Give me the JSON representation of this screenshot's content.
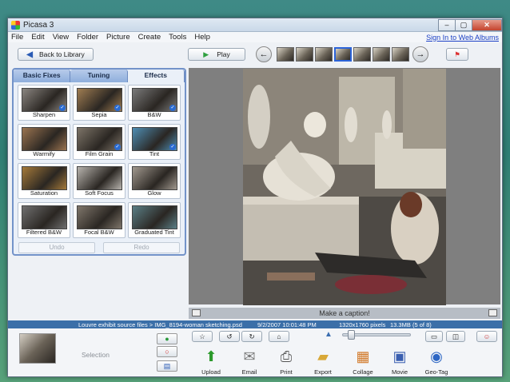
{
  "window": {
    "title": "Picasa 3",
    "controls": [
      "–",
      "▢",
      "✕"
    ]
  },
  "menu": {
    "items": [
      "File",
      "Edit",
      "View",
      "Folder",
      "Picture",
      "Create",
      "Tools",
      "Help"
    ],
    "sign_in": "Sign In to Web Albums"
  },
  "toolbar": {
    "back_label": "Back to Library",
    "play_label": "Play"
  },
  "edit_panel": {
    "tabs": [
      "Basic Fixes",
      "Tuning",
      "Effects"
    ],
    "active_tab": "Effects",
    "effects": [
      {
        "label": "Sharpen",
        "tone": "#8a8580",
        "badge": true
      },
      {
        "label": "Sepia",
        "tone": "#a07d52",
        "badge": true
      },
      {
        "label": "B&W",
        "tone": "#7a7a7a",
        "badge": true
      },
      {
        "label": "Warmify",
        "tone": "#9b7450",
        "badge": false
      },
      {
        "label": "Film Grain",
        "tone": "#7d7468",
        "badge": true
      },
      {
        "label": "Tint",
        "tone": "#4f8fb4",
        "badge": true
      },
      {
        "label": "Saturation",
        "tone": "#a57a3a",
        "badge": false
      },
      {
        "label": "Soft Focus",
        "tone": "#b8b4ae",
        "badge": false
      },
      {
        "label": "Glow",
        "tone": "#a29a90",
        "badge": false
      },
      {
        "label": "Filtered B&W",
        "tone": "#6f6f6f",
        "badge": false
      },
      {
        "label": "Focal B&W",
        "tone": "#7f766b",
        "badge": false
      },
      {
        "label": "Graduated Tint",
        "tone": "#5b7f86",
        "badge": false
      }
    ],
    "undo_label": "Undo",
    "redo_label": "Redo"
  },
  "caption": {
    "placeholder": "Make a caption!"
  },
  "status": {
    "path": "Louvre exhibit source files > IMG_8194-woman sketching.psd",
    "date": "9/2/2007 10:01:48 PM",
    "dimensions": "1320x1760 pixels",
    "size": "13.3MB",
    "position": "(5 of 8)"
  },
  "tray": {
    "selection_label": "Selection",
    "actions": [
      "Upload",
      "Email",
      "Print",
      "Export",
      "Collage",
      "Movie",
      "Geo-Tag"
    ]
  },
  "colors": {
    "accent": "#3b6fa8",
    "panel_border": "#7393c9",
    "status_bg": "#3b6fa8"
  }
}
